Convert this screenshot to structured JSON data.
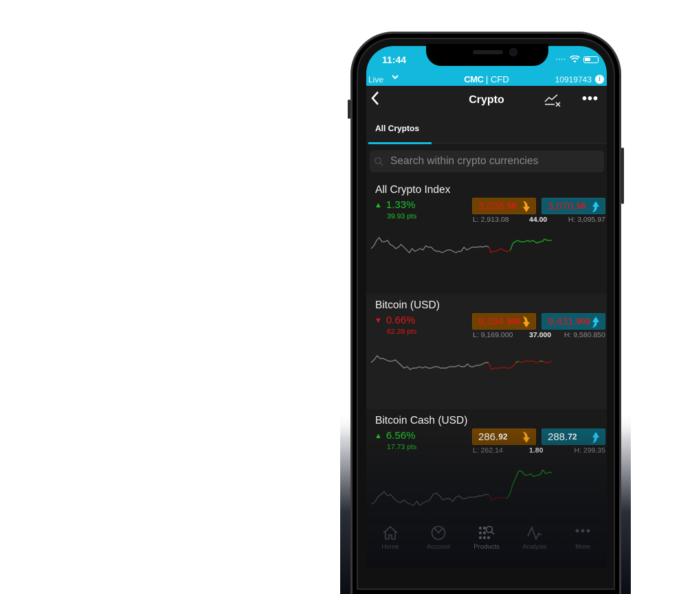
{
  "status_bar": {
    "time": "11:44"
  },
  "account_bar": {
    "mode": "Live",
    "brand": "CMC",
    "brand_suffix": "| CFD",
    "account_number": "10919743"
  },
  "navbar": {
    "title": "Crypto"
  },
  "tabs": [
    {
      "label": "All Cryptos",
      "active": true
    }
  ],
  "search": {
    "placeholder": "Search within crypto currencies",
    "value": ""
  },
  "colors": {
    "accent": "#13b9dc",
    "up": "#1fc22a",
    "down": "#e01818",
    "sell_bg": "#6f4200",
    "buy_bg": "#0d5a6a"
  },
  "markets": [
    {
      "name": "All Crypto Index",
      "direction": "up",
      "change_pct": "1.33%",
      "change_pts": "39.93 pts",
      "sell_main": "3,026.",
      "sell_small": "58",
      "buy_main": "3,070.",
      "buy_small": "58",
      "price_color": "down",
      "low": "L: 2,913.08",
      "spread": "44.00",
      "high": "H: 3,095.97",
      "sparkline": {
        "history": [
          22,
          18,
          10,
          6,
          12,
          12,
          10,
          16,
          18,
          22,
          20,
          16,
          20,
          24,
          28,
          22,
          26,
          24,
          22,
          24,
          18,
          20,
          20,
          24,
          26,
          26,
          28,
          26,
          24,
          24,
          26,
          28,
          26,
          26,
          20,
          24,
          22,
          20,
          20,
          20,
          19,
          20,
          18,
          20
        ],
        "recent": [
          18,
          28,
          26,
          26,
          24,
          22,
          24,
          26,
          26,
          24,
          14,
          12,
          10,
          12,
          12,
          12,
          10,
          12,
          10,
          12,
          14,
          12,
          12,
          8,
          10,
          10,
          10
        ],
        "recent_colors": [
          "down",
          "down",
          "down",
          "down",
          "down",
          "down",
          "down",
          "down",
          "down",
          "down",
          "up",
          "up",
          "up",
          "up",
          "up",
          "up",
          "up",
          "up",
          "up",
          "up",
          "up",
          "up",
          "up",
          "up",
          "up",
          "up",
          "up"
        ]
      }
    },
    {
      "name": "Bitcoin (USD)",
      "direction": "down",
      "change_pct": "0.66%",
      "change_pts": "62.28 pts",
      "sell_main": "9,394.",
      "sell_small": "900",
      "buy_main": "9,431.",
      "buy_small": "900",
      "price_color": "down",
      "low": "L: 9,169.000",
      "spread": "37.000",
      "high": "H: 9,580.850",
      "sparkline": {
        "history": [
          20,
          16,
          10,
          14,
          14,
          16,
          18,
          18,
          16,
          20,
          24,
          28,
          26,
          30,
          28,
          28,
          26,
          28,
          26,
          28,
          28,
          26,
          26,
          28,
          28,
          28,
          26,
          26,
          26,
          24,
          26,
          26,
          22,
          26,
          26,
          24,
          24,
          22,
          20,
          20
        ],
        "recent": [
          20,
          30,
          28,
          28,
          28,
          27,
          28,
          28,
          26,
          20,
          18,
          20,
          18,
          18,
          18,
          18,
          20,
          18,
          18,
          20,
          20,
          18
        ],
        "recent_colors": [
          "down",
          "down",
          "down",
          "down",
          "down",
          "down",
          "down",
          "down",
          "down",
          "down",
          "up",
          "down",
          "down",
          "down",
          "down",
          "down",
          "down",
          "down",
          "up",
          "down",
          "down",
          "down"
        ]
      }
    },
    {
      "name": "Bitcoin Cash (USD)",
      "direction": "up",
      "change_pct": "6.56%",
      "change_pts": "17.73 pts",
      "sell_main": "286.",
      "sell_small": "92",
      "buy_main": "288.",
      "buy_small": "72",
      "price_color": "neutral",
      "low": "L: 262.14",
      "spread": "1.80",
      "high": "H: 299.35",
      "sparkline": {
        "history": [
          58,
          56,
          48,
          44,
          40,
          46,
          44,
          50,
          54,
          56,
          52,
          56,
          58,
          60,
          54,
          60,
          56,
          54,
          52,
          44,
          42,
          46,
          52,
          50,
          50,
          54,
          48,
          46,
          50,
          50,
          48,
          48,
          48,
          46,
          46,
          44,
          44
        ],
        "recent": [
          44,
          52,
          50,
          48,
          50,
          48,
          50,
          44,
          30,
          20,
          10,
          10,
          16,
          16,
          14,
          18,
          16,
          16,
          8,
          14,
          12,
          12
        ],
        "recent_colors": [
          "down",
          "down",
          "down",
          "down",
          "down",
          "down",
          "down",
          "up",
          "up",
          "up",
          "up",
          "up",
          "up",
          "up",
          "up",
          "up",
          "up",
          "up",
          "up",
          "up",
          "up",
          "up"
        ]
      }
    }
  ],
  "tab_bar": [
    {
      "label": "Home",
      "icon": "home-icon",
      "active": false
    },
    {
      "label": "Account",
      "icon": "account-icon",
      "active": false
    },
    {
      "label": "Products",
      "icon": "products-icon",
      "active": true
    },
    {
      "label": "Analysis",
      "icon": "analysis-icon",
      "active": false
    },
    {
      "label": "More",
      "icon": "more-icon",
      "active": false
    }
  ]
}
